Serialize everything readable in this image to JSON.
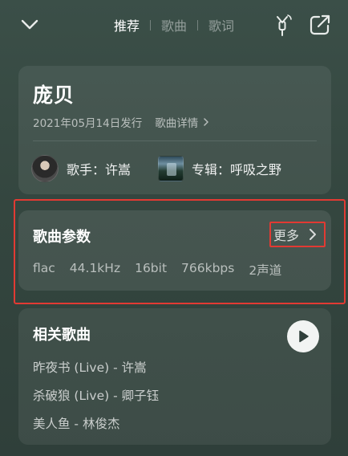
{
  "header": {
    "tabs": [
      {
        "label": "推荐",
        "active": true
      },
      {
        "label": "歌曲",
        "active": false
      },
      {
        "label": "歌词",
        "active": false
      }
    ],
    "icons": [
      "chevron-down-icon",
      "mic-icon",
      "share-icon"
    ]
  },
  "song": {
    "title": "庞贝",
    "release": "2021年05月14日发行",
    "detail_label": "歌曲详情",
    "singer": "歌手：许嵩",
    "album": "专辑：呼吸之野"
  },
  "params": {
    "title": "歌曲参数",
    "more_label": "更多",
    "items": [
      "flac",
      "44.1kHz",
      "16bit",
      "766kbps",
      "2声道"
    ]
  },
  "related": {
    "title": "相关歌曲",
    "songs": [
      "昨夜书 (Live) - 许嵩",
      "杀破狼 (Live) - 卿子钰",
      "美人鱼 - 林俊杰"
    ]
  },
  "colors": {
    "background": "#34463f",
    "highlight": "#e23a33",
    "text": "#ffffff"
  }
}
